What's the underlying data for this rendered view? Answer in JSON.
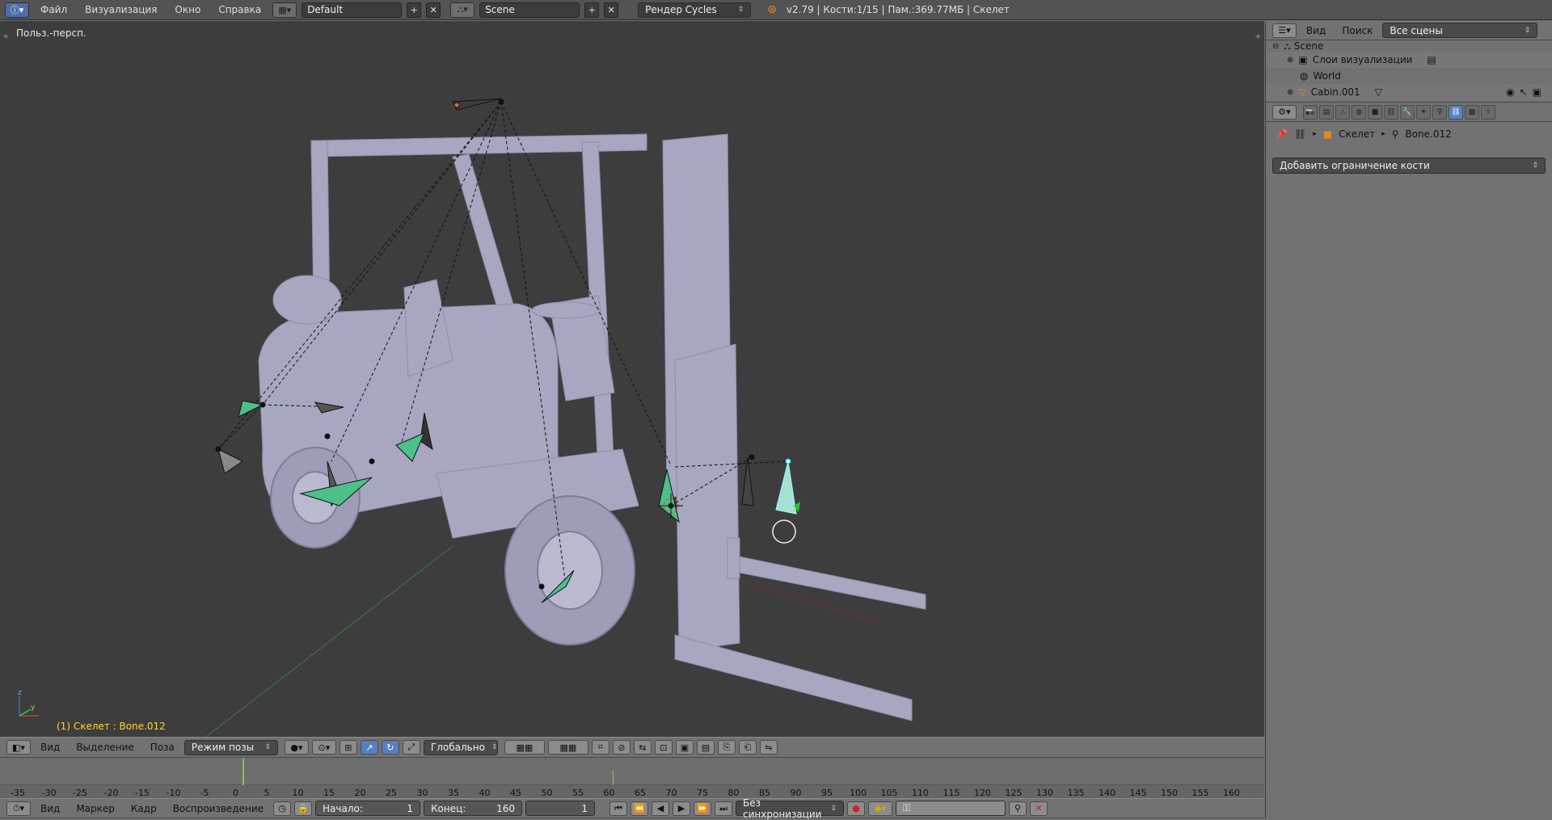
{
  "topbar": {
    "info_icon": "info-icon",
    "menus": [
      "Файл",
      "Визуализация",
      "Окно",
      "Справка"
    ],
    "layout": "Default",
    "scene": "Scene",
    "render_engine": "Рендер Cycles",
    "status": "v2.79 | Кости:1/15 | Пам.:369.77МБ | Скелет"
  },
  "viewport": {
    "view_label": "Польз.-персп.",
    "status_text": "(1) Скелет : Bone.012"
  },
  "view3d_header": {
    "menus": [
      "Вид",
      "Выделение",
      "Поза"
    ],
    "mode": "Режим позы",
    "orientation": "Глобально"
  },
  "timeline": {
    "ticks": [
      "-35",
      "-30",
      "-25",
      "-20",
      "-15",
      "-10",
      "-5",
      "0",
      "5",
      "10",
      "15",
      "20",
      "25",
      "30",
      "35",
      "40",
      "45",
      "50",
      "55",
      "60",
      "65",
      "70",
      "75",
      "80",
      "85",
      "90",
      "95",
      "100",
      "105",
      "110",
      "115",
      "120",
      "125",
      "130",
      "135",
      "140",
      "145",
      "150",
      "155",
      "160"
    ],
    "current_frame": "1",
    "keyframe_marker": "60"
  },
  "timeline_header": {
    "menus": [
      "Вид",
      "Маркер",
      "Кадр",
      "Воспроизведение"
    ],
    "start_label": "Начало:",
    "start_value": "1",
    "end_label": "Конец:",
    "end_value": "160",
    "current_value": "1",
    "sync": "Без синхронизации"
  },
  "outliner": {
    "menus": [
      "Вид",
      "Поиск"
    ],
    "filter": "Все сцены",
    "items": [
      {
        "label": "Scene",
        "icon": "scene-icon"
      },
      {
        "label": "Слои визуализации",
        "icon": "render-layers-icon"
      },
      {
        "label": "World",
        "icon": "world-icon"
      },
      {
        "label": "Cabin.001",
        "icon": "mesh-icon"
      }
    ]
  },
  "properties": {
    "breadcrumb": [
      "Скелет",
      "Bone.012"
    ],
    "add_constraint": "Добавить ограничение кости"
  },
  "colors": {
    "viewport_bg": "#3d3d3d",
    "panel_bg": "#727272",
    "accent_blue": "#5680c2",
    "bone_green": "#4fbf8a",
    "status_yellow": "#ffd23a"
  }
}
